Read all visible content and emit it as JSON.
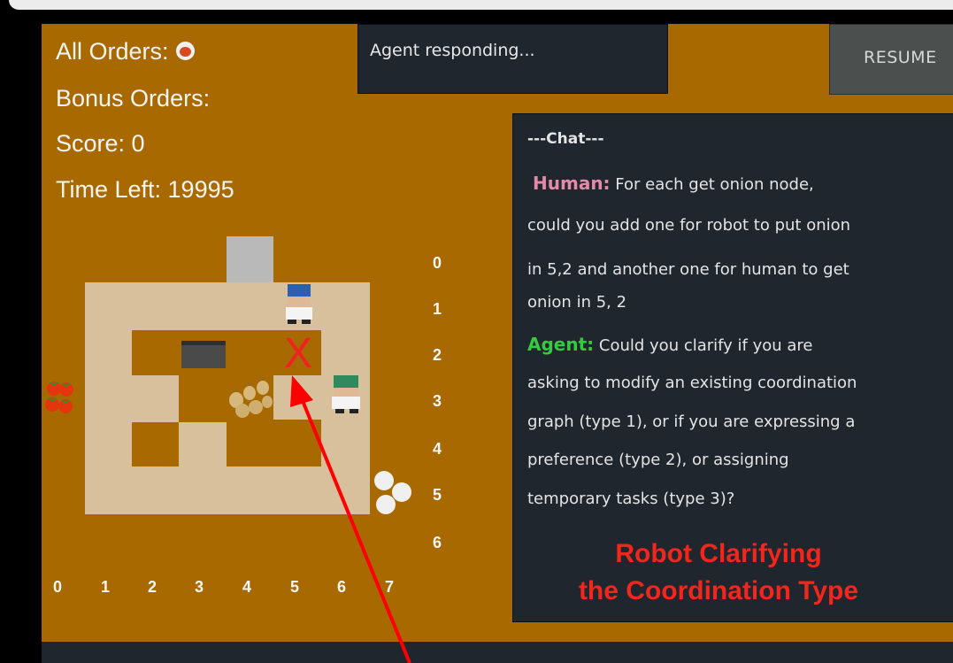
{
  "hud": {
    "all_orders_label": "All Orders:",
    "order_icon": "tomato-soup-icon",
    "bonus_orders_label": "Bonus Orders:",
    "score_label": "Score: 0",
    "time_left_label": "Time Left: 19995"
  },
  "status": {
    "text": "Agent responding..."
  },
  "resume_button": {
    "label": "RESUME"
  },
  "chat": {
    "title": "---Chat---",
    "human_speaker": "Human:",
    "human_lines": [
      "For each get onion node,",
      "could you add one for robot to put onion",
      "in 5,2 and another one for human to get",
      "onion in 5, 2"
    ],
    "agent_speaker": "Agent:",
    "agent_lines": [
      "Could you clarify if you are",
      "asking to modify an existing coordination",
      "graph (type 1), or if you are expressing a",
      "preference (type 2), or assigning",
      "temporary tasks (type 3)?"
    ]
  },
  "caption": {
    "line1": "Robot Clarifying",
    "line2": "the Coordination Type"
  },
  "grid": {
    "row_labels": [
      "0",
      "1",
      "2",
      "3",
      "4",
      "5",
      "6"
    ],
    "col_labels": [
      "0",
      "1",
      "2",
      "3",
      "4",
      "5",
      "6",
      "7"
    ],
    "marker": "X"
  },
  "colors": {
    "background": "#a86a00",
    "floor": "#d8c09c",
    "panel": "#1f262d",
    "human_name": "#e28aa8",
    "agent_name": "#37c93f",
    "annotation": "#f1261c"
  }
}
